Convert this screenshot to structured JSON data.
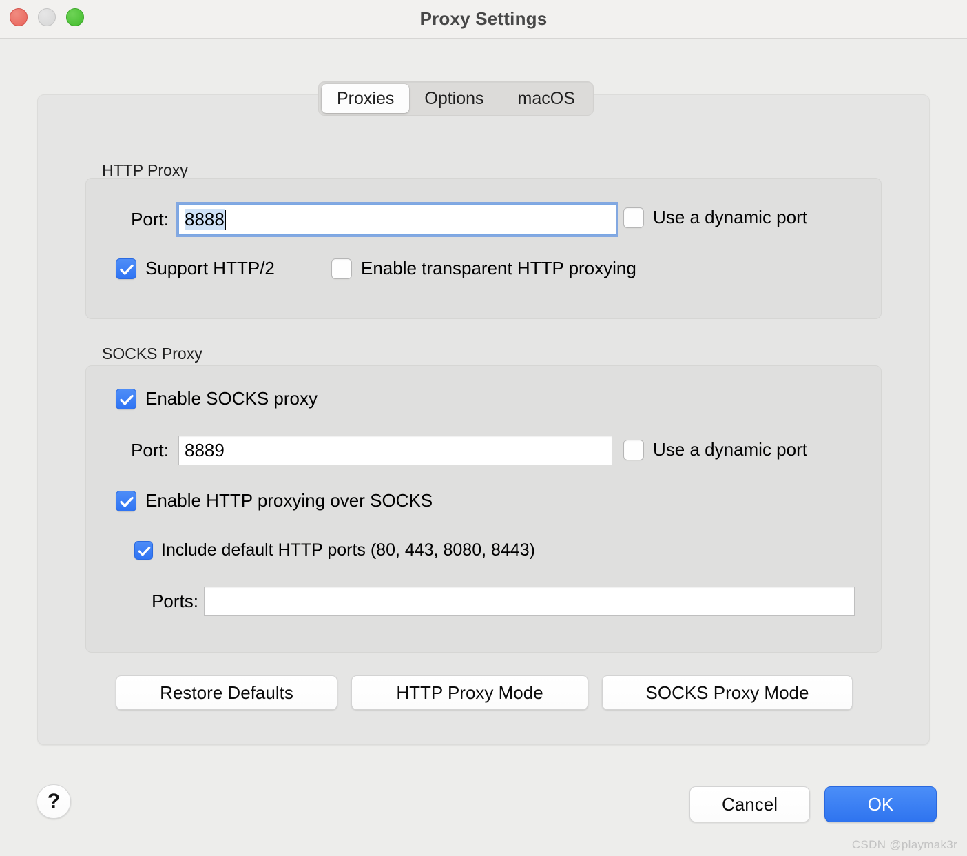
{
  "window": {
    "title": "Proxy Settings",
    "traffic_lights": {
      "close_color": "#e9635a",
      "minimize_color": "#d6d6d6",
      "maximize_color": "#42bb2c"
    }
  },
  "tabs": {
    "items": [
      {
        "label": "Proxies",
        "selected": true
      },
      {
        "label": "Options",
        "selected": false
      },
      {
        "label": "macOS",
        "selected": false
      }
    ]
  },
  "http_proxy": {
    "group_label": "HTTP Proxy",
    "port_label": "Port:",
    "port_value": "8888",
    "port_focused": true,
    "port_selected": true,
    "dynamic_port_label": "Use a dynamic port",
    "dynamic_port_checked": false,
    "support_http2_label": "Support HTTP/2",
    "support_http2_checked": true,
    "transparent_label": "Enable transparent HTTP proxying",
    "transparent_checked": false
  },
  "socks_proxy": {
    "group_label": "SOCKS Proxy",
    "enable_label": "Enable SOCKS proxy",
    "enable_checked": true,
    "port_label": "Port:",
    "port_value": "8889",
    "dynamic_port_label": "Use a dynamic port",
    "dynamic_port_checked": false,
    "http_over_socks_label": "Enable HTTP proxying over SOCKS",
    "http_over_socks_checked": true,
    "include_default_label": "Include default HTTP ports (80, 443, 8080, 8443)",
    "include_default_checked": true,
    "ports_label": "Ports:",
    "ports_value": "",
    "ports_placeholder": ""
  },
  "mode_buttons": {
    "restore_defaults": "Restore Defaults",
    "http_proxy_mode": "HTTP Proxy Mode",
    "socks_proxy_mode": "SOCKS Proxy Mode"
  },
  "footer": {
    "help_glyph": "?",
    "cancel_label": "Cancel",
    "ok_label": "OK",
    "ok_color": "#2f74ef"
  },
  "watermark": {
    "text": "CSDN @playmak3r"
  }
}
